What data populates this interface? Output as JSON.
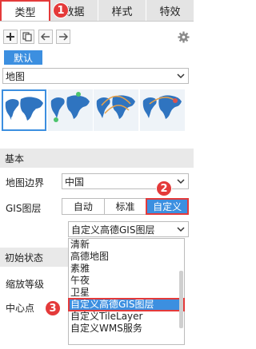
{
  "tabs": [
    {
      "label": "类型"
    },
    {
      "label": "数据"
    },
    {
      "label": "样式"
    },
    {
      "label": "特效"
    }
  ],
  "toolbar": {
    "add_icon": "plus-icon",
    "copy_icon": "copy-icon",
    "left_icon": "arrow-left-icon",
    "right_icon": "arrow-right-icon",
    "settings_icon": "gear-icon"
  },
  "default_button": {
    "label": "默认"
  },
  "chart_type": {
    "value": "地图"
  },
  "thumbnails": [
    {
      "name": "point-map",
      "selected": true
    },
    {
      "name": "area-map",
      "selected": false
    },
    {
      "name": "flow-map",
      "selected": false
    },
    {
      "name": "heat-map",
      "selected": false
    }
  ],
  "basic": {
    "section_title": "基本",
    "map_boundary_label": "地图边界",
    "map_boundary_value": "中国",
    "gis_label": "GIS图层",
    "gis_options": [
      "自动",
      "标准",
      "自定义"
    ],
    "gis_active": "自定义",
    "layer_select_value": "自定义高德GIS图层"
  },
  "hidden_labels": {
    "initial_state": "初始状态",
    "zoom_level": "缩放等级",
    "center": "中心点"
  },
  "dropdown_options": [
    "清新",
    "高德地图",
    "素雅",
    "午夜",
    "卫星",
    "自定义高德GIS图层",
    "自定义TileLayer",
    "自定义WMS服务"
  ],
  "badges": [
    "1",
    "2",
    "3"
  ],
  "colors": {
    "accent": "#3c8fe0",
    "highlight": "#e43a3a"
  }
}
